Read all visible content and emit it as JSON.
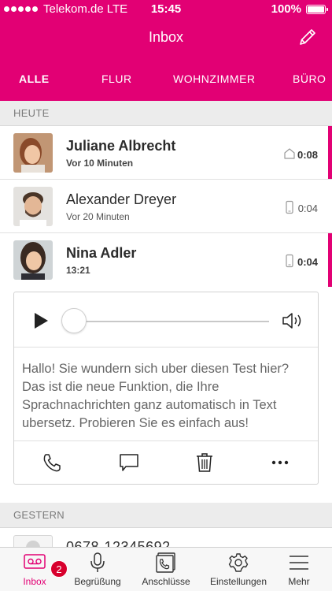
{
  "status_bar": {
    "carrier": "Telekom.de",
    "network": "LTE",
    "time": "15:45",
    "battery": "100%"
  },
  "header": {
    "title": "Inbox"
  },
  "tabs": [
    {
      "label": "ALLE",
      "active": true
    },
    {
      "label": "FLUR",
      "active": false
    },
    {
      "label": "WOHNZIMMER",
      "active": false
    },
    {
      "label": "BÜRO",
      "active": false
    }
  ],
  "sections": {
    "today": "HEUTE",
    "yesterday": "GESTERN"
  },
  "messages": [
    {
      "name": "Juliane Albrecht",
      "subtitle": "Vor 10 Minuten",
      "duration": "0:08",
      "device_icon": "home-icon",
      "unread": true
    },
    {
      "name": "Alexander Dreyer",
      "subtitle": "Vor 20 Minuten",
      "duration": "0:04",
      "device_icon": "mobile-phone-icon",
      "unread": false
    },
    {
      "name": "Nina Adler",
      "subtitle": "13:21",
      "duration": "0:04",
      "device_icon": "mobile-phone-icon",
      "unread": true
    }
  ],
  "player": {
    "progress": 0,
    "transcript": "Hallo! Sie wundern sich uber diesen Test hier? Das ist die neue Funktion, die Ihre Sprachnachrichten ganz automatisch in Text ubersetz. Probieren Sie es einfach aus!"
  },
  "yesterday_messages": [
    {
      "name": "0678-12345692"
    }
  ],
  "tabbar": [
    {
      "label": "Inbox",
      "icon": "voicemail-icon",
      "active": true,
      "badge": "2"
    },
    {
      "label": "Begrüßung",
      "icon": "microphone-icon",
      "active": false
    },
    {
      "label": "Anschlüsse",
      "icon": "phone-devices-icon",
      "active": false
    },
    {
      "label": "Einstellungen",
      "icon": "gear-icon",
      "active": false
    },
    {
      "label": "Mehr",
      "icon": "menu-icon",
      "active": false
    }
  ],
  "colors": {
    "brand": "#e20074",
    "badge": "#d8002d"
  }
}
